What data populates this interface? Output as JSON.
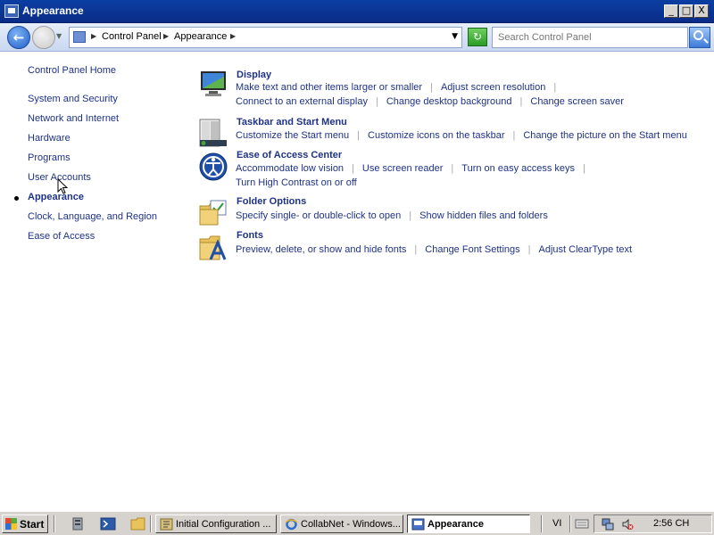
{
  "window": {
    "title": "Appearance",
    "controls": {
      "minimize": "_",
      "maximize": "□",
      "close": "X"
    }
  },
  "address": {
    "breadcrumbs": [
      "Control Panel",
      "Appearance"
    ],
    "search_placeholder": "Search Control Panel"
  },
  "sidebar": {
    "home": "Control Panel Home",
    "items": [
      {
        "label": "System and Security"
      },
      {
        "label": "Network and Internet"
      },
      {
        "label": "Hardware"
      },
      {
        "label": "Programs"
      },
      {
        "label": "User Accounts"
      },
      {
        "label": "Appearance",
        "current": true
      },
      {
        "label": "Clock, Language, and Region"
      },
      {
        "label": "Ease of Access"
      }
    ]
  },
  "categories": [
    {
      "title": "Display",
      "icon": "display-icon",
      "rows": [
        [
          "Make text and other items larger or smaller",
          "Adjust screen resolution"
        ],
        [
          "Connect to an external display",
          "Change desktop background",
          "Change screen saver"
        ]
      ]
    },
    {
      "title": "Taskbar and Start Menu",
      "icon": "taskbar-icon",
      "rows": [
        [
          "Customize the Start menu",
          "Customize icons on the taskbar",
          "Change the picture on the Start menu"
        ]
      ]
    },
    {
      "title": "Ease of Access Center",
      "icon": "ease-of-access-icon",
      "rows": [
        [
          "Accommodate low vision",
          "Use screen reader",
          "Turn on easy access keys"
        ],
        [
          "Turn High Contrast on or off"
        ]
      ]
    },
    {
      "title": "Folder Options",
      "icon": "folder-options-icon",
      "rows": [
        [
          "Specify single- or double-click to open",
          "Show hidden files and folders"
        ]
      ]
    },
    {
      "title": "Fonts",
      "icon": "fonts-icon",
      "rows": [
        [
          "Preview, delete, or show and hide fonts",
          "Change Font Settings",
          "Adjust ClearType text"
        ]
      ]
    }
  ],
  "taskbar": {
    "start_label": "Start",
    "buttons": [
      {
        "label": "Initial Configuration ...",
        "icon": "config-icon",
        "active": false
      },
      {
        "label": "CollabNet - Windows...",
        "icon": "ie-icon",
        "active": false
      },
      {
        "label": "Appearance",
        "icon": "control-panel-icon",
        "active": true
      }
    ],
    "language": "VI",
    "clock": "2:56 CH"
  }
}
